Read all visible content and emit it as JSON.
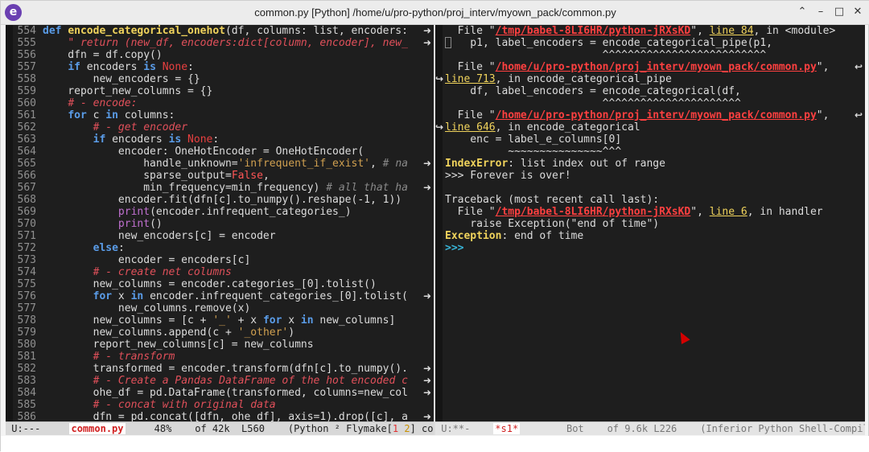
{
  "window": {
    "title": "common.py [Python] /home/u/pro-python/proj_interv/myown_pack/common.py"
  },
  "editor": {
    "lines": [
      {
        "n": "554",
        "t": "def encode_categorical_onehot(df, columns: list, encoders:"
      },
      {
        "n": "555",
        "t": "    \" return (new_df, encoders:dict[column, encoder], new_"
      },
      {
        "n": "556",
        "t": "    dfn = df.copy()"
      },
      {
        "n": "557",
        "t": "    if encoders is None:"
      },
      {
        "n": "558",
        "t": "        new_encoders = {}"
      },
      {
        "n": "559",
        "t": "    report_new_columns = {}"
      },
      {
        "n": "560",
        "t": "    # - encode:"
      },
      {
        "n": "561",
        "t": "    for c in columns:"
      },
      {
        "n": "562",
        "t": "        # - get encoder"
      },
      {
        "n": "563",
        "t": "        if encoders is None:"
      },
      {
        "n": "564",
        "t": "            encoder: OneHotEncoder = OneHotEncoder("
      },
      {
        "n": "565",
        "t": "                handle_unknown='infrequent_if_exist', # na"
      },
      {
        "n": "566",
        "t": "                sparse_output=False,"
      },
      {
        "n": "567",
        "t": "                min_frequency=min_frequency) # all that ha"
      },
      {
        "n": "568",
        "t": "            encoder.fit(dfn[c].to_numpy().reshape(-1, 1))"
      },
      {
        "n": "569",
        "t": "            print(encoder.infrequent_categories_)"
      },
      {
        "n": "570",
        "t": "            print()"
      },
      {
        "n": "571",
        "t": "            new_encoders[c] = encoder"
      },
      {
        "n": "572",
        "t": "        else:"
      },
      {
        "n": "573",
        "t": "            encoder = encoders[c]"
      },
      {
        "n": "574",
        "t": "        # - create net columns"
      },
      {
        "n": "575",
        "t": "        new_columns = encoder.categories_[0].tolist()"
      },
      {
        "n": "576",
        "t": "        for x in encoder.infrequent_categories_[0].tolist("
      },
      {
        "n": "577",
        "t": "            new_columns.remove(x)"
      },
      {
        "n": "578",
        "t": "        new_columns = [c + '_' + x for x in new_columns]"
      },
      {
        "n": "579",
        "t": "        new_columns.append(c + '_other')"
      },
      {
        "n": "580",
        "t": "        report_new_columns[c] = new_columns"
      },
      {
        "n": "581",
        "t": "        # - transform"
      },
      {
        "n": "582",
        "t": "        transformed = encoder.transform(dfn[c].to_numpy()."
      },
      {
        "n": "583",
        "t": "        # - Create a Pandas DataFrame of the hot encoded c"
      },
      {
        "n": "584",
        "t": "        ohe_df = pd.DataFrame(transformed, columns=new_col"
      },
      {
        "n": "585",
        "t": "        # - concat with original data"
      },
      {
        "n": "586",
        "t": "        dfn = pd.concat([dfn, ohe_df], axis=1).drop([c], a"
      }
    ]
  },
  "shell": {
    "l1_pre": "  File \"",
    "l1_link": "/tmp/babel-8LI6HR/python-jRXsKD",
    "l1_mid": "\", ",
    "l1_line": "line 84",
    "l1_post": ", in <module>",
    "l2": "    p1, label_encoders = encode_categorical_pipe(p1,",
    "l3": "                         ^^^^^^^^^^^^^^^^^^^^^^^^^^",
    "l4_pre": "  File \"",
    "l4_link": "/home/u/pro-python/proj_interv/myown_pack/common.py",
    "l4_post": "\",",
    "l5_line": "line 713",
    "l5_post": ", in encode_categorical_pipe",
    "l6": "    df, label_encoders = encode_categorical(df,",
    "l7": "                         ^^^^^^^^^^^^^^^^^^^^^^",
    "l8_pre": "  File \"",
    "l8_link": "/home/u/pro-python/proj_interv/myown_pack/common.py",
    "l8_post": "\",",
    "l9_line": "line 646",
    "l9_post": ", in encode_categorical",
    "l10": "    enc = label_e_columns[0]",
    "l11": "          ~~~~~~~~~~~~~~~^^^",
    "l12_err": "IndexError",
    "l12_post": ": list index out of range",
    "l13": ">>> Forever is over!",
    "l14": "Traceback (most recent call last):",
    "l15_pre": "  File \"",
    "l15_link": "/tmp/babel-8LI6HR/python-jRXsKD",
    "l15_mid": "\", ",
    "l15_line": "line 6",
    "l15_post": ", in handler",
    "l16": "    raise Exception(\"end of time\")",
    "l17_err": "Exception",
    "l17_post": ": end of time",
    "l18": ">>>"
  },
  "modeline_left": {
    "state": "U:---",
    "buffer": "common.py",
    "pct": "48%",
    "size": "of 42k",
    "line": "L560",
    "mode": "(Python ² Flymake[",
    "fm1": "1",
    "fm2": "2",
    "rest": "] company"
  },
  "modeline_right": {
    "state": "U:**-",
    "buffer": "*s1*",
    "pos": "Bot",
    "size": "of 9.6k",
    "line": "L226",
    "mode": "(Inferior Python Shell-Compile d"
  },
  "icons": {
    "app": "emacs-icon",
    "min": "minimize-icon",
    "max": "maximize-icon",
    "close": "close-icon",
    "up": "chevron-up-icon"
  }
}
